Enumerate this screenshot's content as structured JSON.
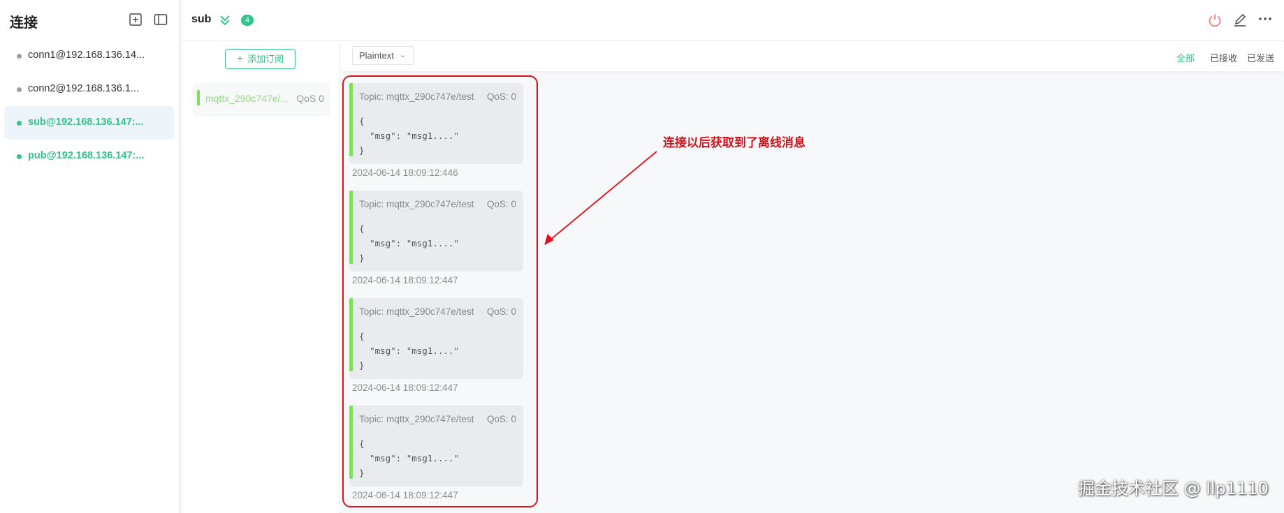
{
  "sidebar": {
    "title": "连接",
    "connections": [
      {
        "label": "conn1@192.168.136.14...",
        "online": false,
        "active": false
      },
      {
        "label": "conn2@192.168.136.1...",
        "online": false,
        "active": false
      },
      {
        "label": "sub@192.168.136.147:...",
        "online": true,
        "active": true
      },
      {
        "label": "pub@192.168.136.147:...",
        "online": true,
        "active": false
      }
    ]
  },
  "header": {
    "connection_name": "sub",
    "subscription_count": "4"
  },
  "subscriptions": {
    "add_button_label": "添加订阅",
    "items": [
      {
        "topic": "mqttx_290c747e/...",
        "qos": "QoS 0"
      }
    ]
  },
  "messages_toolbar": {
    "format": "Plaintext",
    "filters": {
      "all": "全部",
      "received": "已接收",
      "sent": "已发送"
    }
  },
  "messages": [
    {
      "topic": "Topic: mqttx_290c747e/test",
      "qos": "QoS: 0",
      "body": "{\n  \"msg\": \"msg1....\"\n}",
      "time": "2024-06-14 18:09:12:446"
    },
    {
      "topic": "Topic: mqttx_290c747e/test",
      "qos": "QoS: 0",
      "body": "{\n  \"msg\": \"msg1....\"\n}",
      "time": "2024-06-14 18:09:12:447"
    },
    {
      "topic": "Topic: mqttx_290c747e/test",
      "qos": "QoS: 0",
      "body": "{\n  \"msg\": \"msg1....\"\n}",
      "time": "2024-06-14 18:09:12:447"
    },
    {
      "topic": "Topic: mqttx_290c747e/test",
      "qos": "QoS: 0",
      "body": "{\n  \"msg\": \"msg1....\"\n}",
      "time": "2024-06-14 18:09:12:447"
    }
  ],
  "annotation": "连接以后获取到了离线消息",
  "watermark": "掘金技术社区 @ llp1110",
  "colors": {
    "accent": "#34c388",
    "highlight": "#e0101a",
    "message_bar": "#7fe05a"
  },
  "icons": [
    "new-connection-icon",
    "toggle-sidebar-icon",
    "expand-chevrons-icon",
    "power-icon",
    "edit-icon",
    "more-icon"
  ]
}
